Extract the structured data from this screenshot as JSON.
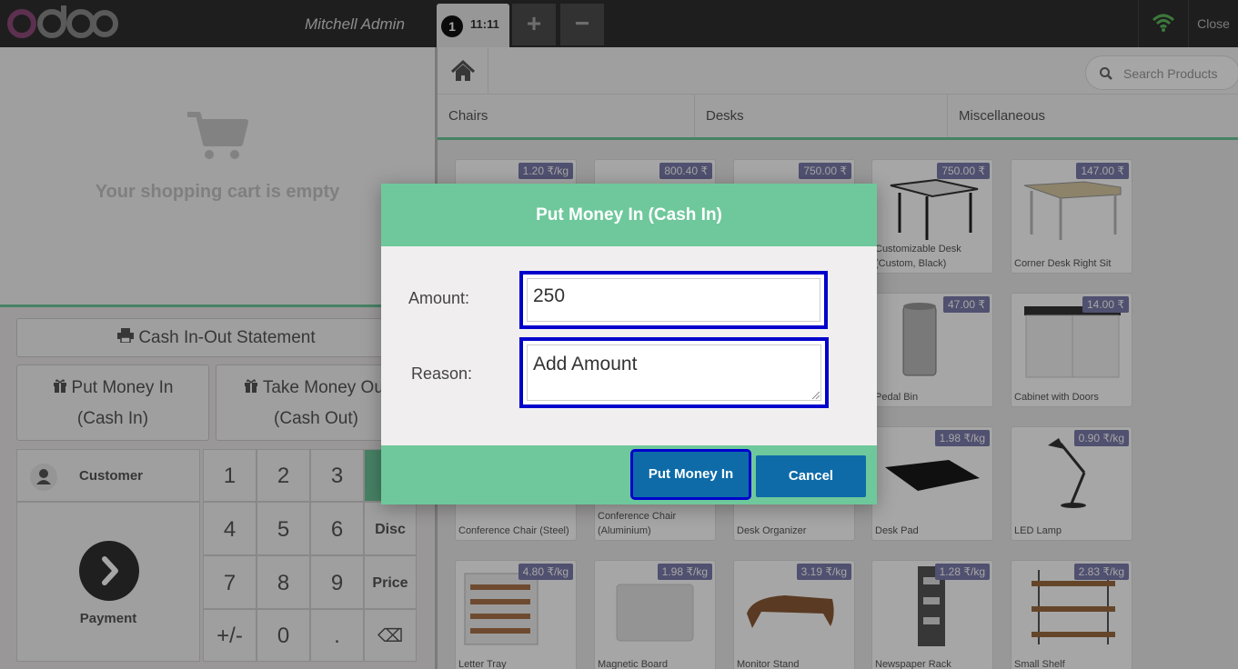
{
  "topbar": {
    "cashier": "Mitchell Admin",
    "order_number": "1",
    "order_time": "11:11",
    "add_order": "+",
    "remove_order": "−",
    "close": "Close",
    "wifi_color": "#5cb85c"
  },
  "cart": {
    "empty_text": "Your shopping cart is empty"
  },
  "actions": {
    "statement": "Cash In-Out Statement",
    "put_in_line1": "Put Money In",
    "put_in_line2": "(Cash In)",
    "take_out_line1": "Take Money Out",
    "take_out_line2": "(Cash Out)"
  },
  "numpad": {
    "customer": "Customer",
    "payment": "Payment",
    "keys": [
      "1",
      "2",
      "3",
      "4",
      "5",
      "6",
      "7",
      "8",
      "9",
      "+/-",
      "0",
      "."
    ],
    "disc": "Disc",
    "price": "Price",
    "backspace": "⌫"
  },
  "search": {
    "placeholder": "Search Products"
  },
  "categories": [
    "Chairs",
    "Desks",
    "Miscellaneous"
  ],
  "products": [
    {
      "name": "",
      "price": "1.20 ₹/kg"
    },
    {
      "name": "",
      "price": "800.40 ₹"
    },
    {
      "name": "",
      "price": "750.00 ₹"
    },
    {
      "name": "Customizable Desk (Custom, Black)",
      "price": "750.00 ₹"
    },
    {
      "name": "Corner Desk Right Sit",
      "price": "147.00 ₹"
    },
    {
      "name": "Pedal Bin",
      "price": "47.00 ₹"
    },
    {
      "name": "Cabinet with Doors",
      "price": "14.00 ₹"
    },
    {
      "name": "Conference Chair (Steel)",
      "price": ""
    },
    {
      "name": "Conference Chair (Aluminium)",
      "price": ""
    },
    {
      "name": "Desk Organizer",
      "price": ""
    },
    {
      "name": "Desk Pad",
      "price": "1.98 ₹/kg"
    },
    {
      "name": "LED Lamp",
      "price": "0.90 ₹/kg"
    },
    {
      "name": "Letter Tray",
      "price": "4.80 ₹/kg"
    },
    {
      "name": "Magnetic Board",
      "price": "1.98 ₹/kg"
    },
    {
      "name": "Monitor Stand",
      "price": "3.19 ₹/kg"
    },
    {
      "name": "Newspaper Rack",
      "price": "1.28 ₹/kg"
    },
    {
      "name": "Small Shelf",
      "price": "2.83 ₹/kg"
    }
  ],
  "modal": {
    "title": "Put Money In (Cash In)",
    "amount_label": "Amount:",
    "amount_value": "250",
    "reason_label": "Reason:",
    "reason_value": "Add Amount",
    "confirm": "Put Money In",
    "cancel": "Cancel"
  },
  "colors": {
    "accent": "#6ec89b",
    "button": "#0e6ba8",
    "price_badge": "#7c7bad",
    "highlight": "#0000cc"
  }
}
